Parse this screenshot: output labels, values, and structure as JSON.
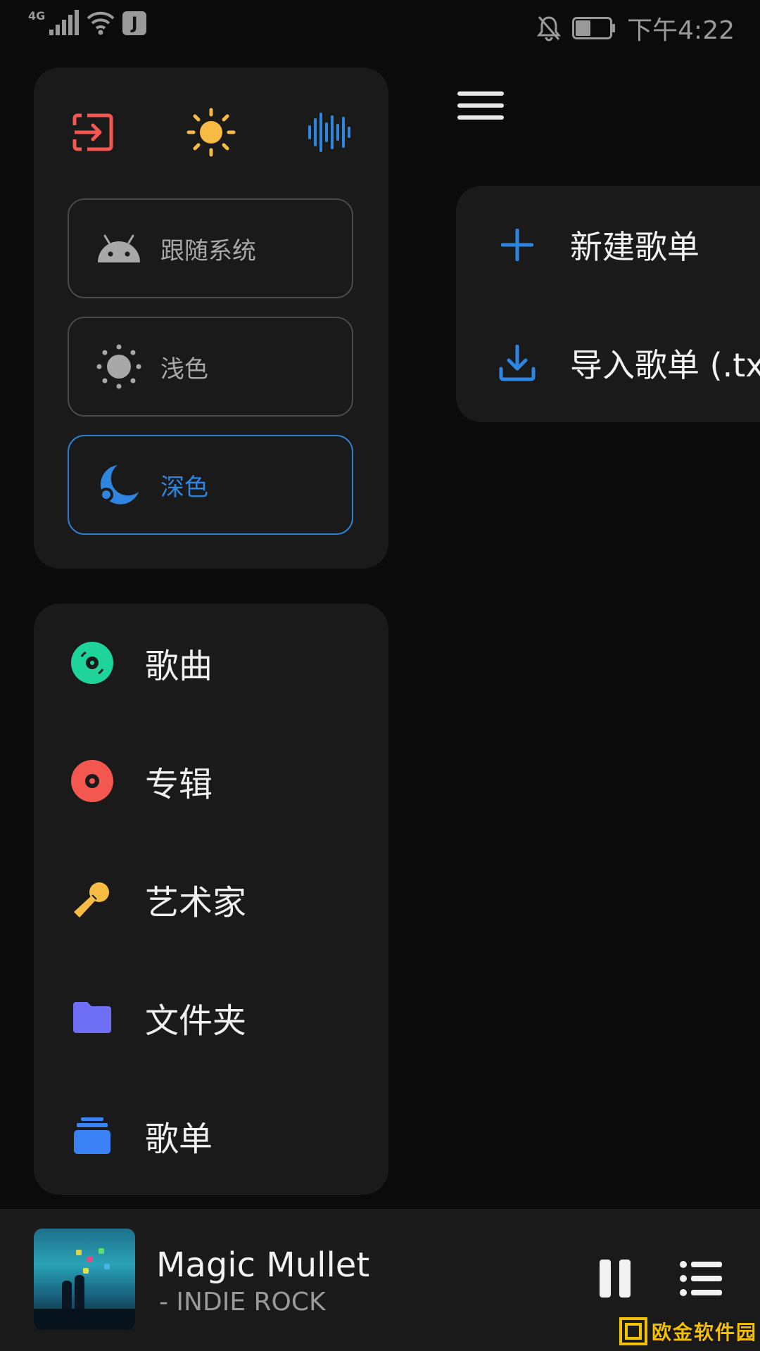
{
  "status_bar": {
    "network": "4G",
    "app_badge": "J",
    "time": "下午4:22",
    "battery_level": 0.45,
    "icons": [
      "signal-icon",
      "wifi-icon",
      "app-notification-icon",
      "mute-bell-icon",
      "battery-icon"
    ]
  },
  "theme_card": {
    "quick_icons": [
      "logout-icon",
      "sun-icon",
      "equalizer-icon"
    ],
    "options": [
      {
        "label": "跟随系统",
        "icon": "android-icon",
        "selected": false
      },
      {
        "label": "浅色",
        "icon": "sun-icon",
        "selected": false
      },
      {
        "label": "深色",
        "icon": "moon-icon",
        "selected": true
      }
    ]
  },
  "nav": {
    "items": [
      {
        "label": "歌曲",
        "icon": "disc-icon",
        "color": "#1fd49a"
      },
      {
        "label": "专辑",
        "icon": "vinyl-icon",
        "color": "#f4574f"
      },
      {
        "label": "艺术家",
        "icon": "microphone-icon",
        "color": "#f6bb42"
      },
      {
        "label": "文件夹",
        "icon": "folder-icon",
        "color": "#6f6ff5"
      },
      {
        "label": "歌单",
        "icon": "playlist-stack-icon",
        "color": "#3b82f6"
      }
    ]
  },
  "playlist_menu": {
    "items": [
      {
        "label": "新建歌单",
        "icon": "plus-icon"
      },
      {
        "label": "导入歌单 (.txt",
        "icon": "download-icon"
      }
    ]
  },
  "player": {
    "title": "Magic Mullet",
    "artist": "- INDIE ROCK"
  },
  "watermark": {
    "text": "欧金软件园"
  },
  "colors": {
    "accent_blue": "#2f86e0",
    "card_bg": "#1a1a1b",
    "page_bg": "#0b0b0b"
  }
}
